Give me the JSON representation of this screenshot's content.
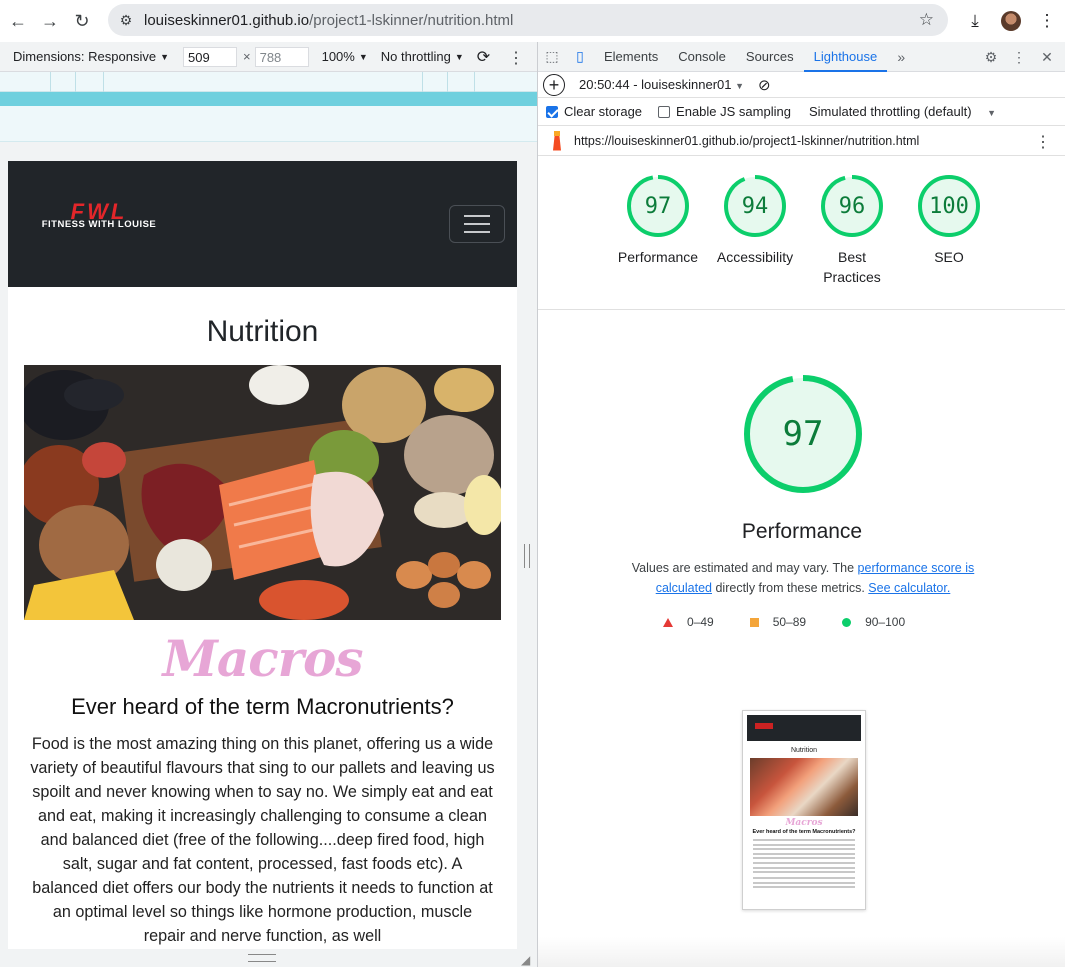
{
  "browser": {
    "url_host": "louiseskinner01.github.io",
    "url_path": "/project1-lskinner/nutrition.html"
  },
  "device_toolbar": {
    "dimensions_label": "Dimensions: Responsive",
    "width": "509",
    "height": "788",
    "zoom": "100%",
    "throttling": "No throttling"
  },
  "site": {
    "logo_mark": "FWL",
    "logo_text": "FITNESS WITH LOUISE",
    "page_title": "Nutrition",
    "macros_heading": "Macros",
    "subheading": "Ever heard of the term Macronutrients?",
    "body": "Food is the most amazing thing on this planet, offering us a wide variety of beautiful flavours that sing to our pallets and leaving us spoilt and never knowing when to say no. We simply eat and eat and eat, making it increasingly challenging to consume a clean and balanced diet (free of the following....deep fired food, high salt, sugar and fat content, processed, fast foods etc). A balanced diet offers our body the nutrients it needs to function at an optimal level so things like hormone production, muscle repair and nerve function, as well"
  },
  "devtools": {
    "tabs": [
      "Elements",
      "Console",
      "Sources",
      "Lighthouse"
    ],
    "active_tab": "Lighthouse",
    "report_time": "20:50:44 - louiseskinner01",
    "clear_storage": "Clear storage",
    "js_sampling": "Enable JS sampling",
    "throttling": "Simulated throttling (default)",
    "audited_url": "https://louiseskinner01.github.io/project1-lskinner/nutrition.html"
  },
  "scores": [
    {
      "label": "Performance",
      "value": 97
    },
    {
      "label": "Accessibility",
      "value": 94
    },
    {
      "label": "Best Practices",
      "value": 96
    },
    {
      "label": "SEO",
      "value": 100
    }
  ],
  "performance": {
    "value": 97,
    "title": "Performance",
    "desc_pre": "Values are estimated and may vary. The ",
    "desc_link1": "performance score is calculated",
    "desc_mid": " directly from these metrics. ",
    "desc_link2": "See calculator.",
    "legend": [
      "0–49",
      "50–89",
      "90–100"
    ]
  },
  "thumbnail": {
    "title": "Nutrition",
    "macros": "Macros",
    "sub": "Ever heard of the term Macronutrients?"
  },
  "colors": {
    "pass": "#0cce6b",
    "pass_text": "#0c7c3a",
    "average": "#f4a53a",
    "fail": "#e53935",
    "accent": "#1a73e8",
    "macros_pink": "#e7a6d6",
    "nav_dark": "#212529"
  }
}
